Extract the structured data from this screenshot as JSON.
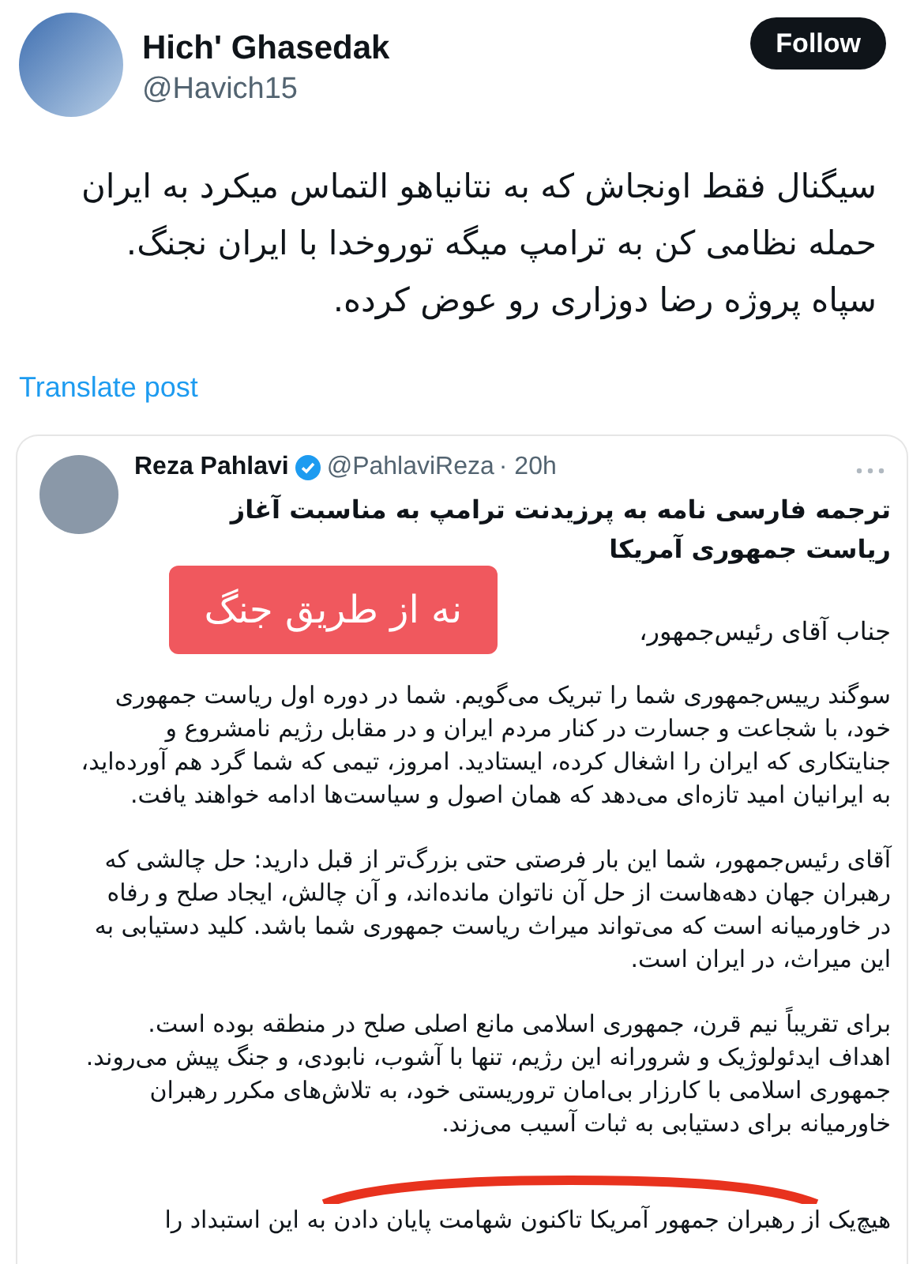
{
  "post": {
    "author": "Hich' Ghasedak",
    "handle": "@Havich15",
    "follow_label": "Follow",
    "text_lines": [
      "سیگنال فقط اونجاش که به نتانیاهو التماس میکرد به ایران",
      "حمله نظامی کن به ترامپ میگه توروخدا با ایران نجنگ.",
      "سپاه پروژه رضا دوزاری رو عوض کرده."
    ],
    "translate": "Translate post"
  },
  "quote": {
    "author": "Reza Pahlavi",
    "verified": true,
    "handle": "@PahlaviReza",
    "time": "· 20h",
    "title": "ترجمه فارسی نامه به پرزیدنت ترامپ به مناسبت آغاز ریاست جمهوری آمریکا",
    "label": "نه از طریق جنگ",
    "salutation": "جناب آقای رئیس‌جمهور،",
    "paragraphs": [
      {
        "text": "سوگند رییس‌جمهوری شما را تبریک می‌گویم. شما در دوره اول ریاست جمهوری خود، با شجاعت و جسارت در کنار مردم ایران و در مقابل رژیم نامشروع و جنایتکاری که ایران را اشغال کرده، ایستادید. امروز، تیمی که شما گرد هم آورده‌اید، به ایرانیان امید تازه‌ای می‌دهد که همان اصول و سیاست‌ها ادامه خواهند یافت."
      },
      {
        "text": "آقای رئیس‌جمهور، شما این بار فرصتی حتی بزرگ‌تر از قبل دارید: حل چالشی که رهبران جهان دهه‌هاست از حل آن ناتوان مانده‌اند، و آن چالش، ایجاد صلح و رفاه در خاورمیانه است که می‌تواند میراث ریاست جمهوری شما باشد. کلید دستیابی به این میراث، در ایران است."
      },
      {
        "text": "برای تقریباً نیم قرن، جمهوری اسلامی مانع اصلی صلح در منطقه بوده است. اهداف ایدئولوژیک و شرورانه این رژیم، تنها با آشوب، نابودی، و جنگ پیش می‌روند. جمهوری اسلامی با کارزار بی‌امان تروریستی خود، به تلاش‌های مکرر رهبران خاورمیانه برای دستیابی به ثبات آسیب می‌زند."
      }
    ],
    "last_line": "هیچ‌یک از رهبران جمهور آمریکا تاکنون شهامت پایان دادن به این استبداد را"
  }
}
